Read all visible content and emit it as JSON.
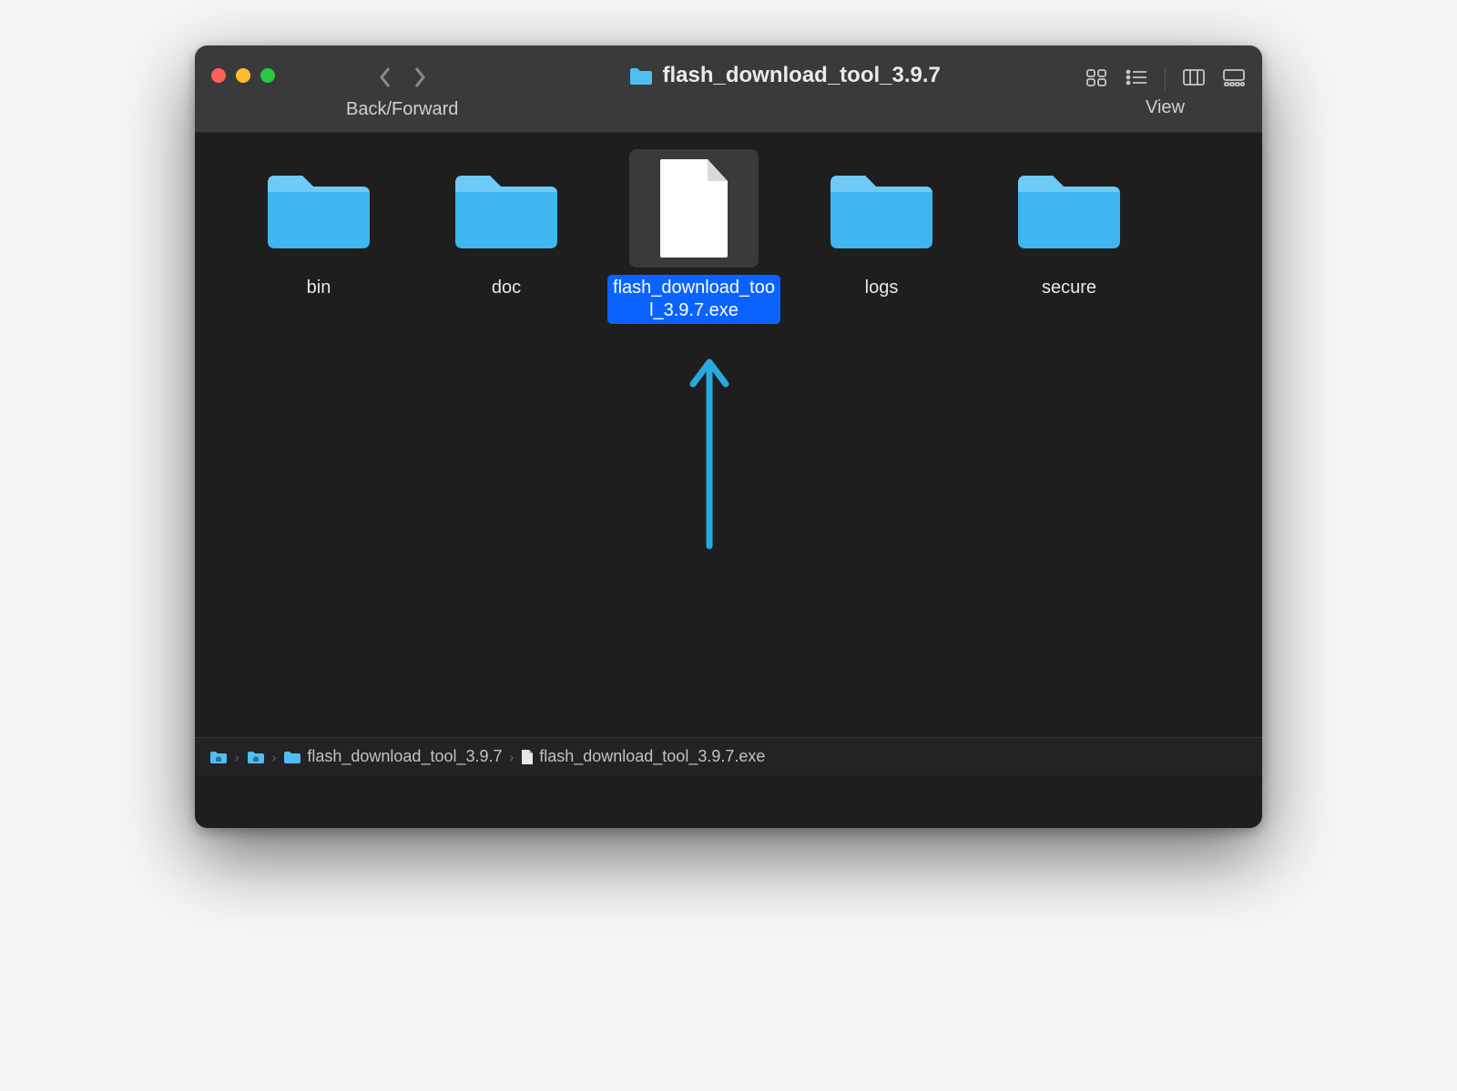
{
  "toolbar": {
    "nav_label": "Back/Forward",
    "title": "flash_download_tool_3.9.7",
    "view_label": "View"
  },
  "items": [
    {
      "name": "bin",
      "type": "folder",
      "selected": false
    },
    {
      "name": "doc",
      "type": "folder",
      "selected": false
    },
    {
      "name": "flash_download_tool_3.9.7.exe",
      "type": "file",
      "selected": true
    },
    {
      "name": "logs",
      "type": "folder",
      "selected": false
    },
    {
      "name": "secure",
      "type": "folder",
      "selected": false
    }
  ],
  "pathbar": {
    "segments": [
      {
        "kind": "folder-home",
        "name": ""
      },
      {
        "kind": "folder-home",
        "name": ""
      },
      {
        "kind": "folder",
        "name": "flash_download_tool_3.9.7"
      },
      {
        "kind": "file",
        "name": "flash_download_tool_3.9.7.exe"
      }
    ]
  },
  "colors": {
    "folder_light": "#6fcaf6",
    "folder_dark": "#3eb6ef",
    "selection": "#0a63ff",
    "arrow": "#2aa9e0"
  }
}
